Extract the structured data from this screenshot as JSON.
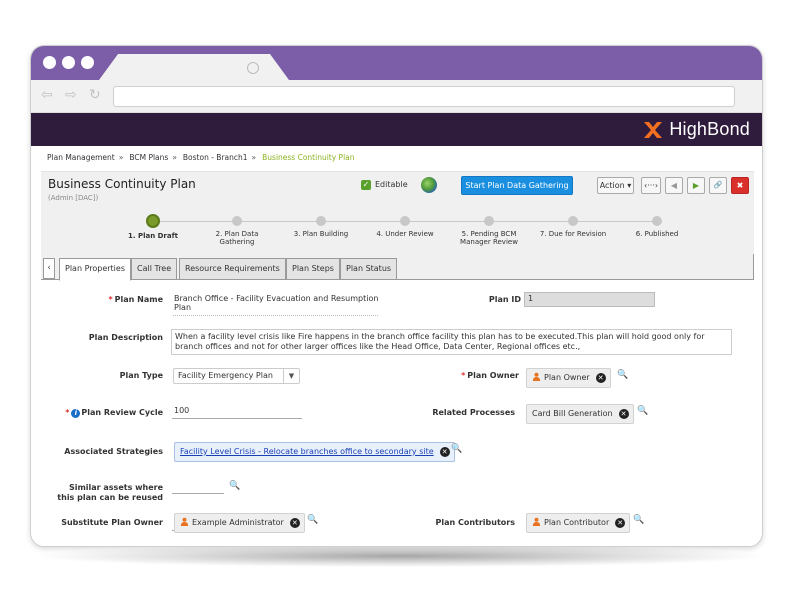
{
  "app": {
    "brand": "HighBond",
    "brand_color": "#2f1b3c",
    "accent_color": "#7b5ea7",
    "primary_color": "#1a8fe0"
  },
  "browser": {
    "tab_icon": "globe-icon",
    "nav_icons": [
      "back-arrow-icon",
      "forward-arrow-icon",
      "reload-icon"
    ]
  },
  "breadcrumb": {
    "items": [
      "Plan Management",
      "BCM Plans",
      "Boston - Branch1"
    ],
    "separator": "»",
    "current": "Business Continuity Plan"
  },
  "header": {
    "title": "Business Continuity Plan",
    "subtitle": "(Admin [DAC])",
    "editable_label": "Editable",
    "primary_button": "Start Plan Data Gathering",
    "action_button": "Action ▾",
    "tool_buttons": {
      "diff": "‹···›",
      "prev": "◀",
      "next": "▶",
      "link": "🔗",
      "close": "✖"
    }
  },
  "workflow": {
    "steps": [
      {
        "label": "1. Plan Draft",
        "active": true
      },
      {
        "label": "2. Plan Data Gathering",
        "active": false
      },
      {
        "label": "3. Plan Building",
        "active": false
      },
      {
        "label": "4. Under Review",
        "active": false
      },
      {
        "label": "5. Pending BCM Manager Review",
        "active": false
      },
      {
        "label": "7. Due for Revision",
        "active": false
      },
      {
        "label": "6. Published",
        "active": false
      }
    ]
  },
  "tabs": [
    {
      "label": "Plan Properties",
      "active": true
    },
    {
      "label": "Call Tree",
      "active": false
    },
    {
      "label": "Resource Requirements",
      "active": false
    },
    {
      "label": "Plan Steps",
      "active": false
    },
    {
      "label": "Plan Status",
      "active": false
    }
  ],
  "form": {
    "required_mark": "*",
    "plan_name": {
      "label": "Plan Name",
      "value": "Branch Office - Facility Evacuation and Resumption Plan"
    },
    "plan_id": {
      "label": "Plan ID",
      "value": "1"
    },
    "plan_description": {
      "label": "Plan Description",
      "value": "When a facility level crisis like Fire happens in the branch office facility this plan has to be executed.This plan will hold good only for branch offices and not for other larger offices like the Head Office, Data Center, Regional offices etc.,"
    },
    "plan_type": {
      "label": "Plan Type",
      "value": "Facility Emergency Plan"
    },
    "plan_owner": {
      "label": "Plan Owner",
      "value": "Plan Owner"
    },
    "plan_review_cycle": {
      "label": "Plan Review Cycle",
      "value": "100"
    },
    "related_processes": {
      "label": "Related Processes",
      "value": "Card Bill Generation"
    },
    "associated_strategies": {
      "label": "Associated Strategies",
      "value": "Facility Level Crisis - Relocate branches office to secondary site"
    },
    "similar_assets": {
      "label_line1": "Similar assets where",
      "label_line2": "this plan can be reused",
      "value": ""
    },
    "substitute_plan_owner": {
      "label": "Substitute Plan Owner",
      "value": "Example Administrator"
    },
    "plan_contributors": {
      "label": "Plan Contributors",
      "value": "Plan Contributor"
    },
    "remove_glyph": "✕",
    "search_glyph": "🔍",
    "dropdown_glyph": "▼"
  }
}
